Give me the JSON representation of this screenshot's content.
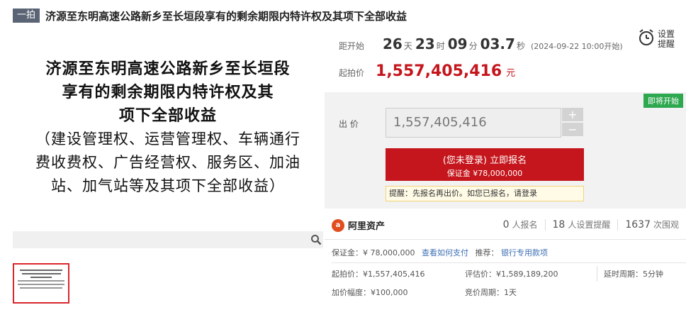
{
  "header": {
    "tag": "一拍",
    "title": "济源至东明高速公路新乡至长垣段享有的剩余期限内特许权及其项下全部收益"
  },
  "image": {
    "lines": [
      "济源至东明高速公路新乡至长垣段",
      "享有的剩余期限内特许权及其",
      "项下全部收益",
      "（建设管理权、运营管理权、车辆通行",
      "费收费权、广告经营权、服务区、加油",
      "站、加气站等及其项下全部收益）"
    ]
  },
  "countdown": {
    "label": "距开始",
    "days": "26",
    "days_unit": "天",
    "hours": "23",
    "hours_unit": "时",
    "minutes": "09",
    "minutes_unit": "分",
    "seconds": "03.7",
    "seconds_unit": "秒",
    "start_note": "(2024-09-22 10:00开始)"
  },
  "reminder": {
    "label": "设置提醒"
  },
  "starting_price": {
    "label": "起拍价",
    "value": "1,557,405,416",
    "unit": "元"
  },
  "bid": {
    "badge": "即将开始",
    "label": "出 价",
    "value": "1,557,405,416",
    "plus": "+",
    "minus": "−",
    "signup_line1": "(您未登录) 立即报名",
    "signup_line2": "保证金 ¥78,000,000",
    "notice": "提醒：先报名再出价。如您已报名，请登录"
  },
  "platform": {
    "name": "阿里资产",
    "stats": [
      {
        "num": "0",
        "label": "人报名"
      },
      {
        "num": "18",
        "label": "人设置提醒"
      },
      {
        "num": "1637",
        "label": "次围观"
      }
    ]
  },
  "info": {
    "deposit": "保证金：¥ 78,000,000",
    "how_to_pay": "查看如何支付",
    "recommend": "推荐：",
    "bank_pay": "银行专用款项",
    "start_price": "起拍价：¥1,557,405,416",
    "appraisal": "评估价：¥1,589,189,200",
    "delay": "延时周期：5分钟",
    "increment": "加价幅度：¥100,000",
    "bid_cycle": "竞价周期：1天"
  },
  "colors": {
    "accent_red": "#c4161c",
    "badge_green": "#2ea84f",
    "link_blue": "#3d6fb4"
  }
}
